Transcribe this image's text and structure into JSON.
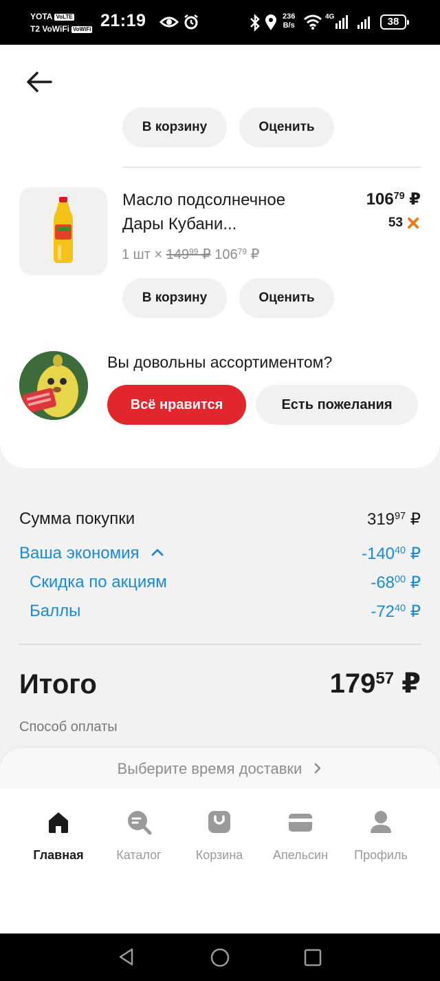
{
  "status": {
    "carrier1": "YOTA",
    "carrier1_tag": "VoLTE",
    "carrier2": "T2 VoWiFi",
    "carrier2_tag": "VoWiFi",
    "time": "21:19",
    "speed_value": "236",
    "speed_unit": "B/s",
    "network": "4G",
    "battery": "38"
  },
  "prev_item": {
    "cart_label": "В корзину",
    "rate_label": "Оценить"
  },
  "product": {
    "name_line1": "Масло подсолнечное",
    "name_line2": "Дары Кубани...",
    "price_int": "106",
    "price_frac": "79",
    "currency": "₽",
    "points": "53",
    "qty": "1 шт",
    "times": "×",
    "old_int": "149",
    "old_frac": "99",
    "new_int": "106",
    "new_frac": "79",
    "cart_label": "В корзину",
    "rate_label": "Оценить"
  },
  "feedback": {
    "question": "Вы довольны ассортиментом?",
    "like_label": "Всё нравится",
    "wish_label": "Есть пожелания"
  },
  "summary": {
    "sum_label": "Сумма покупки",
    "sum_int": "319",
    "sum_frac": "97",
    "economy_label": "Ваша экономия",
    "economy_int": "-140",
    "economy_frac": "40",
    "promo_label": "Скидка по акциям",
    "promo_int": "-68",
    "promo_frac": "00",
    "points_label": "Баллы",
    "points_int": "-72",
    "points_frac": "40",
    "total_label": "Итого",
    "total_int": "179",
    "total_frac": "57",
    "currency": "₽",
    "payment_label": "Способ оплаты"
  },
  "delivery": {
    "label": "Выберите время доставки",
    "chevron": ">"
  },
  "tabs": [
    {
      "label": "Главная",
      "icon": "home-icon"
    },
    {
      "label": "Каталог",
      "icon": "catalog-search-icon"
    },
    {
      "label": "Корзина",
      "icon": "bag-icon"
    },
    {
      "label": "Апельсин",
      "icon": "card-icon"
    },
    {
      "label": "Профиль",
      "icon": "profile-icon"
    }
  ],
  "colors": {
    "accent_red": "#e2262d",
    "accent_blue": "#1a8ad6",
    "points_orange": "#f07a1a"
  }
}
